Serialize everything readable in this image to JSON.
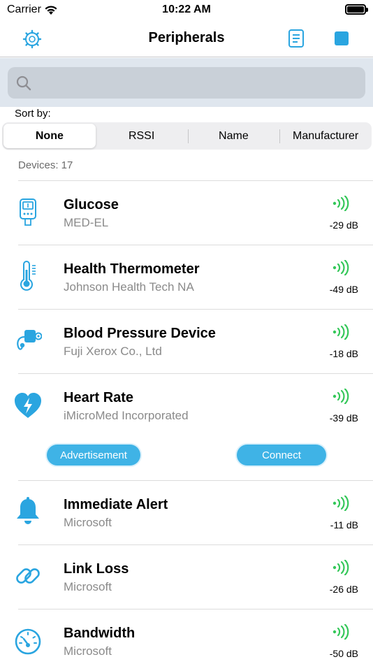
{
  "status_bar": {
    "carrier": "Carrier",
    "time": "10:22 AM"
  },
  "nav": {
    "title": "Peripherals",
    "left_icon": "settings-gear-icon",
    "log_icon": "log-document-icon",
    "stop_icon": "stop-scan-icon"
  },
  "search": {
    "placeholder": "",
    "icon": "search-icon"
  },
  "sort": {
    "label": "Sort by:",
    "options": [
      "None",
      "RSSI",
      "Name",
      "Manufacturer"
    ],
    "selected": "None"
  },
  "device_count": "Devices: 17",
  "accent_color": "#2aa5e0",
  "signal_color": "#34c759",
  "devices": [
    {
      "name": "Glucose",
      "manufacturer": "MED-EL",
      "rssi": "-29 dB",
      "icon": "glucose-meter-icon"
    },
    {
      "name": "Health Thermometer",
      "manufacturer": "Johnson Health Tech NA",
      "rssi": "-49 dB",
      "icon": "thermometer-icon"
    },
    {
      "name": "Blood Pressure Device",
      "manufacturer": "Fuji Xerox Co., Ltd",
      "rssi": "-18 dB",
      "icon": "blood-pressure-icon"
    },
    {
      "name": "Heart Rate",
      "manufacturer": "iMicroMed Incorporated",
      "rssi": "-39 dB",
      "icon": "heart-rate-icon",
      "actions": {
        "advertisement": "Advertisement",
        "connect": "Connect"
      }
    },
    {
      "name": "Immediate Alert",
      "manufacturer": "Microsoft",
      "rssi": "-11 dB",
      "icon": "bell-icon"
    },
    {
      "name": "Link Loss",
      "manufacturer": "Microsoft",
      "rssi": "-26 dB",
      "icon": "link-icon"
    },
    {
      "name": "Bandwidth",
      "manufacturer": "Microsoft",
      "rssi": "-50 dB",
      "icon": "gauge-icon"
    }
  ]
}
